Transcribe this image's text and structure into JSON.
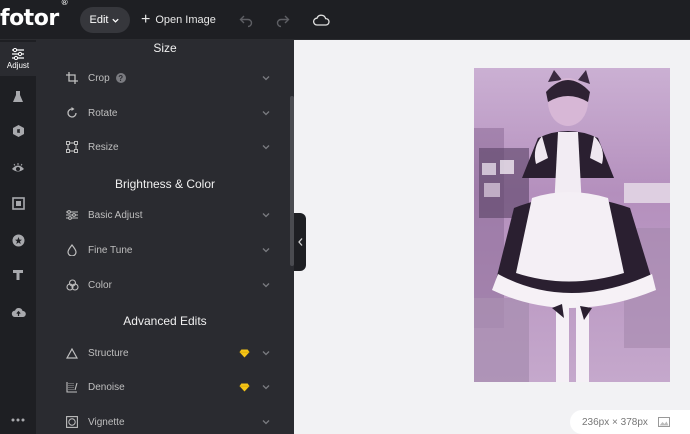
{
  "app": {
    "logo": "fotor",
    "logo_mark": "®"
  },
  "topbar": {
    "edit_label": "Edit",
    "open_image_label": "Open Image",
    "icons": [
      "undo-icon",
      "redo-icon",
      "cloud-icon"
    ]
  },
  "rail": {
    "active_label": "Adjust",
    "items": [
      "adjust-icon",
      "flask-icon",
      "effects-icon",
      "eye-icon",
      "frame-icon",
      "sticker-icon",
      "text-icon",
      "upload-icon",
      "more-icon"
    ]
  },
  "panel": {
    "sections": [
      {
        "title": "Size",
        "items": [
          {
            "label": "Crop",
            "icon": "crop-icon",
            "help": "?"
          },
          {
            "label": "Rotate",
            "icon": "rotate-icon"
          },
          {
            "label": "Resize",
            "icon": "resize-icon"
          }
        ]
      },
      {
        "title": "Brightness & Color",
        "items": [
          {
            "label": "Basic Adjust",
            "icon": "sliders-icon"
          },
          {
            "label": "Fine Tune",
            "icon": "drop-icon"
          },
          {
            "label": "Color",
            "icon": "color-circles-icon"
          }
        ]
      },
      {
        "title": "Advanced Edits",
        "items": [
          {
            "label": "Structure",
            "icon": "triangle-icon",
            "premium": true
          },
          {
            "label": "Denoise",
            "icon": "denoise-icon",
            "premium": true
          },
          {
            "label": "Vignette",
            "icon": "vignette-icon"
          }
        ]
      }
    ]
  },
  "canvas": {
    "size_label": "236px × 378px"
  },
  "colors": {
    "topbar_bg": "#1e1f23",
    "panel_bg": "#2a2b30",
    "canvas_bg": "#f2f2f4",
    "premium_gem": "#f5c518"
  }
}
